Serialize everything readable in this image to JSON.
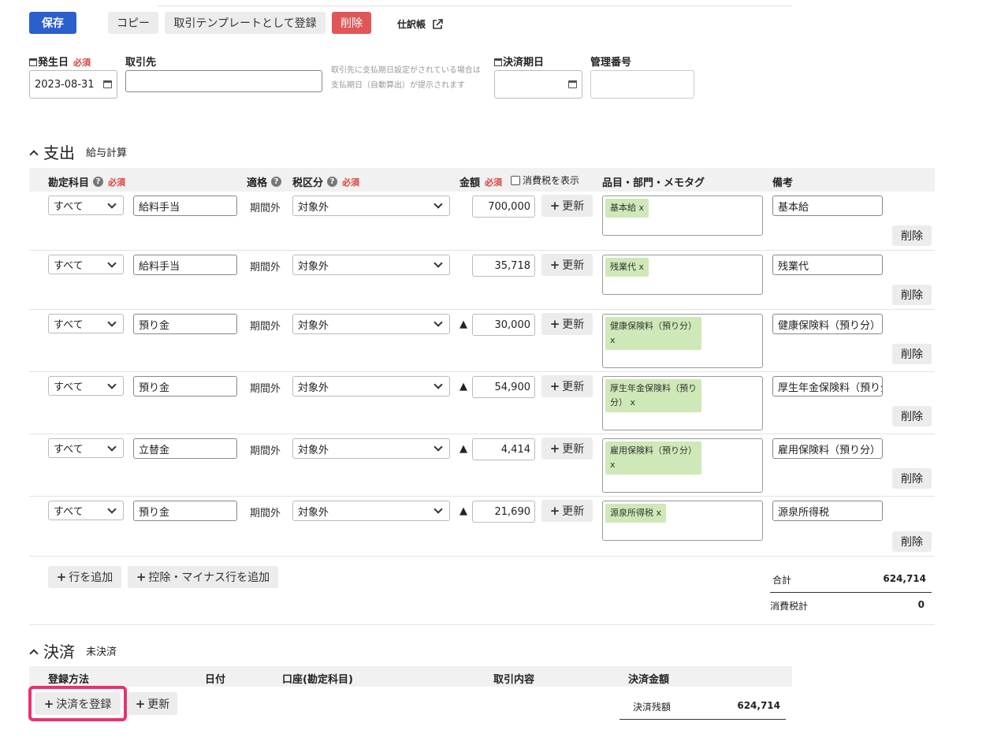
{
  "toolbar": {
    "save": "保存",
    "copy": "コピー",
    "register_template": "取引テンプレートとして登録",
    "delete": "削除",
    "journal": "仕訳帳"
  },
  "header": {
    "date_label": "発生日",
    "required": "必須",
    "date_value": "2023-08-31",
    "partner_label": "取引先",
    "partner_value": "",
    "hint_line1": "取引先に支払期日設定がされている場合は",
    "hint_line2": "支払期日（自動算出）が提示されます",
    "due_label": "決済期日",
    "due_value": "",
    "mgmt_label": "管理番号",
    "mgmt_value": ""
  },
  "expense": {
    "title": "支出",
    "subtitle": "給与計算",
    "col_account": "勘定科目",
    "col_qualified": "適格",
    "col_tax": "税区分",
    "col_amount": "金額",
    "show_tax": "消費税を表示",
    "col_tags": "品目・部門・メモタグ",
    "col_note": "備考",
    "update_label": "更新",
    "delete_label": "削除",
    "rows": [
      {
        "filter": "すべて",
        "account": "給料手当",
        "qualified": "期間外",
        "tax": "対象外",
        "minus": "",
        "amount": "700,000",
        "tag": "基本給 x",
        "note": "基本給"
      },
      {
        "filter": "すべて",
        "account": "給料手当",
        "qualified": "期間外",
        "tax": "対象外",
        "minus": "",
        "amount": "35,718",
        "tag": "残業代 x",
        "note": "残業代"
      },
      {
        "filter": "すべて",
        "account": "預り金",
        "qualified": "期間外",
        "tax": "対象外",
        "minus": "▲",
        "amount": "30,000",
        "tag_l1": "健康保険料（預り分）",
        "tag_l2": "x",
        "note": "健康保険料（預り分）"
      },
      {
        "filter": "すべて",
        "account": "預り金",
        "qualified": "期間外",
        "tax": "対象外",
        "minus": "▲",
        "amount": "54,900",
        "tag_l1": "厚生年金保険料（預り",
        "tag_l2": "分） x",
        "note": "厚生年金保険料（預り分"
      },
      {
        "filter": "すべて",
        "account": "立替金",
        "qualified": "期間外",
        "tax": "対象外",
        "minus": "▲",
        "amount": "4,414",
        "tag_l1": "雇用保険料（預り分）",
        "tag_l2": "x",
        "note": "雇用保険料（預り分）"
      },
      {
        "filter": "すべて",
        "account": "預り金",
        "qualified": "期間外",
        "tax": "対象外",
        "minus": "▲",
        "amount": "21,690",
        "tag": "源泉所得税 x",
        "note": "源泉所得税"
      }
    ],
    "add_row": "行を追加",
    "add_minus_row": "控除・マイナス行を追加",
    "total_label": "合計",
    "total_value": "624,714",
    "tax_label": "消費税計",
    "tax_value": "0"
  },
  "settlement": {
    "title": "決済",
    "subtitle": "未決済",
    "col_method": "登録方法",
    "col_date": "日付",
    "col_account": "口座(勘定科目)",
    "col_content": "取引内容",
    "col_amount": "決済金額",
    "register": "決済を登録",
    "update": "更新",
    "balance_label": "決済残額",
    "balance_value": "624,714"
  },
  "colors": {
    "primary": "#2b5fce",
    "danger": "#e15757",
    "tag": "#cfe8b8",
    "highlight": "#e8336f"
  }
}
